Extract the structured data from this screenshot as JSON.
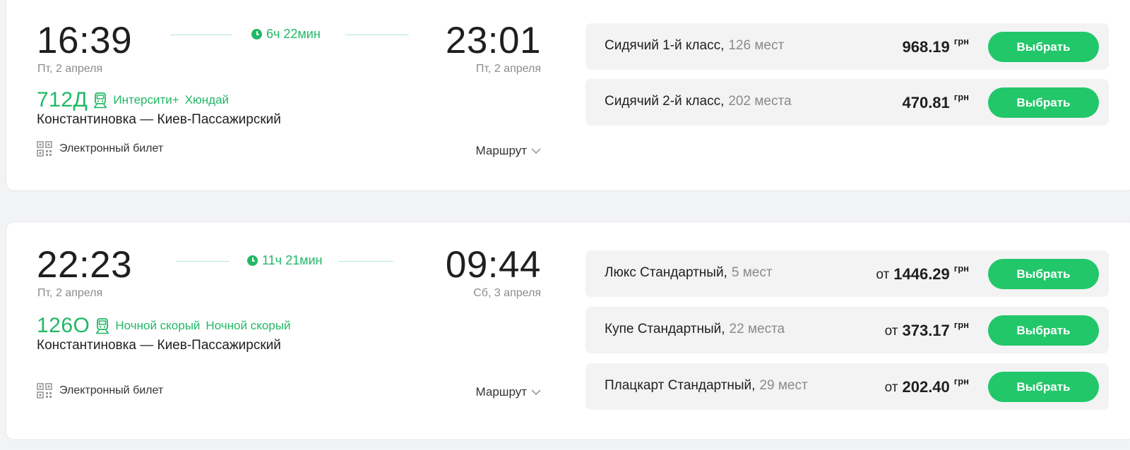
{
  "trips": [
    {
      "departure_time": "16:39",
      "departure_date": "Пт, 2 апреля",
      "arrival_time": "23:01",
      "arrival_date": "Пт, 2 апреля",
      "duration": "6ч 22мин",
      "train_number": "712Д",
      "train_type_1": "Интерсити+",
      "train_type_2": "Хюндай",
      "route": "Константиновка — Киев-Пассажирский",
      "eticket_label": "Электронный билет",
      "route_link": "Маршрут",
      "offers": [
        {
          "class": "Сидячий 1-й класс,",
          "seats": "126 мест",
          "from": "",
          "price": "968.19",
          "currency": "грн",
          "button": "Выбрать"
        },
        {
          "class": "Сидячий 2-й класс,",
          "seats": "202 места",
          "from": "",
          "price": "470.81",
          "currency": "грн",
          "button": "Выбрать"
        }
      ]
    },
    {
      "departure_time": "22:23",
      "departure_date": "Пт, 2 апреля",
      "arrival_time": "09:44",
      "arrival_date": "Сб, 3 апреля",
      "duration": "11ч 21мин",
      "train_number": "126О",
      "train_type_1": "Ночной скорый",
      "train_type_2": "Ночной скорый",
      "route": "Константиновка — Киев-Пассажирский",
      "eticket_label": "Электронный билет",
      "route_link": "Маршрут",
      "offers": [
        {
          "class": "Люкс Стандартный,",
          "seats": "5 мест",
          "from": "от",
          "price": "1446.29",
          "currency": "грн",
          "button": "Выбрать"
        },
        {
          "class": "Купе Стандартный,",
          "seats": "22 места",
          "from": "от",
          "price": "373.17",
          "currency": "грн",
          "button": "Выбрать"
        },
        {
          "class": "Плацкарт Стандартный,",
          "seats": "29 мест",
          "from": "от",
          "price": "202.40",
          "currency": "грн",
          "button": "Выбрать"
        }
      ]
    }
  ],
  "colors": {
    "accent": "#22c76a",
    "accent_text": "#21b866",
    "page_bg": "#f2f3f5",
    "offer_bg": "#f3f3f4"
  },
  "icons": [
    "clock-icon",
    "train-icon",
    "qr-code-icon",
    "chevron-down-icon"
  ]
}
